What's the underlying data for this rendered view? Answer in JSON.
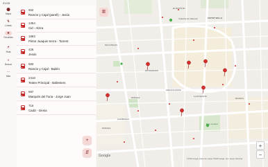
{
  "status": {
    "time": "21:03"
  },
  "rail": {
    "items": [
      {
        "label": "Mapa",
        "icon": "map-pin-icon"
      },
      {
        "label": "Líneas",
        "icon": "swap-icon"
      },
      {
        "label": "Favoritas",
        "icon": "star-icon"
      },
      {
        "label": "Ruta",
        "icon": "route-icon"
      },
      {
        "label": "Buscar",
        "icon": "search-icon"
      },
      {
        "label": "Más",
        "icon": "more-icon"
      }
    ]
  },
  "stops": [
    {
      "code": "652",
      "name": "Ramón y Cajal (parell) - Jesús"
    },
    {
      "code": "1354",
      "name": "Cid - Alzira"
    },
    {
      "code": "1883",
      "name": "Pintor Juaquin Serra - Torrent"
    },
    {
      "code": "426",
      "name": "Jesús"
    },
    {
      "code": "583",
      "name": "Ramón y Cajal - Bailén"
    },
    {
      "code": "2418",
      "name": "Teatre Principal - Ballesters"
    },
    {
      "code": "687",
      "name": "Marqués del Turia - Jorge Juan"
    },
    {
      "code": "716",
      "name": "Cadiz - Denia"
    }
  ],
  "map": {
    "labels": [
      "Catedral de Valencia",
      "CIUTAT VELLA",
      "NOU MOLES",
      "EL BOTÀNIC",
      "EXTRAMURS",
      "LA ROQUETA",
      "PATRAIX",
      "Parc Central",
      "RUZAFA",
      "PATRAIX",
      "ARRANCAPINS",
      "GAMBANAS"
    ],
    "google": "Google",
    "attribution": "©2025 Google, Datos de mapas ©2025 Google, Inst. Geogr. Nacional",
    "zoom_in": "+",
    "zoom_out": "−"
  },
  "colors": {
    "accent": "#c62828",
    "fab_bg": "#f6d9d6"
  }
}
